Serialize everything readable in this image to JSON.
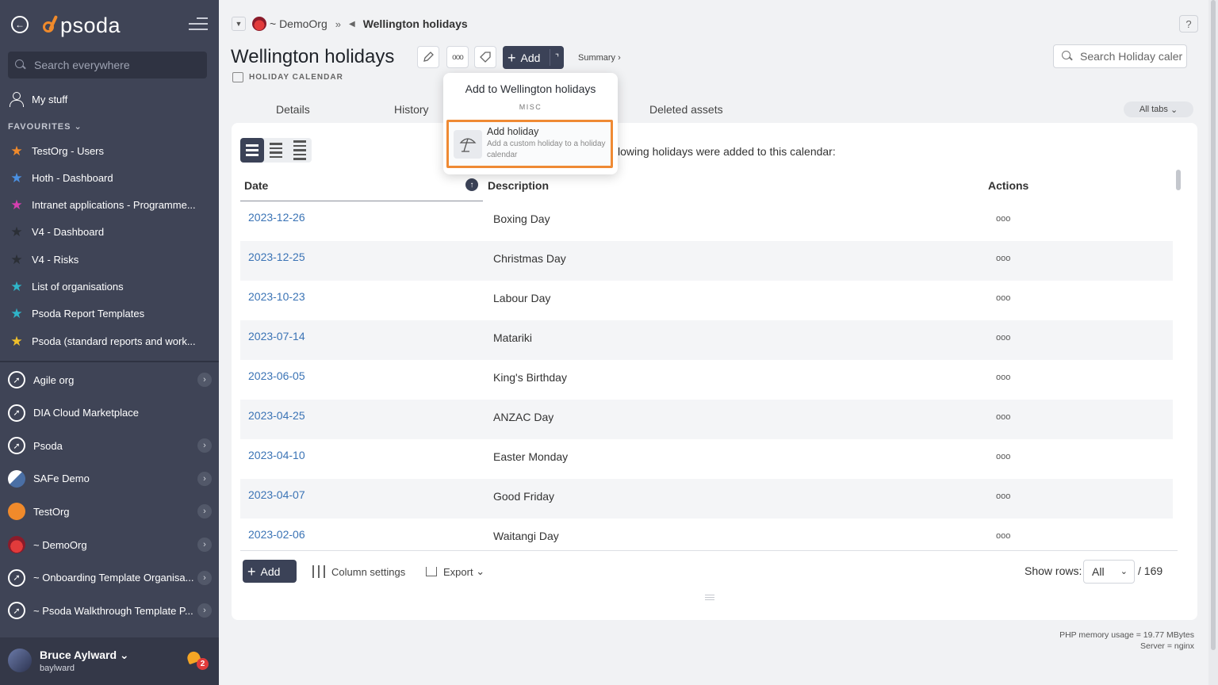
{
  "sidebar": {
    "logo_text": "psoda",
    "search_placeholder": "Search everywhere",
    "my_stuff": "My stuff",
    "favourites_heading": "FAVOURITES",
    "favourites": [
      {
        "label": "TestOrg - Users",
        "color": "#f08a2b"
      },
      {
        "label": "Hoth - Dashboard",
        "color": "#4a90e2"
      },
      {
        "label": "Intranet applications - Programme...",
        "color": "#d63fb0"
      },
      {
        "label": "V4 - Dashboard",
        "color": "#2b2f36"
      },
      {
        "label": "V4 - Risks",
        "color": "#2b2f36"
      },
      {
        "label": "List of organisations",
        "color": "#2fb5c9"
      },
      {
        "label": "Psoda Report Templates",
        "color": "#2fb5c9"
      },
      {
        "label": "Psoda (standard reports and work...",
        "color": "#f0c02b"
      }
    ],
    "orgs": [
      {
        "label": "Agile org",
        "has_chevron": true
      },
      {
        "label": "DIA Cloud Marketplace",
        "has_chevron": false
      },
      {
        "label": "Psoda",
        "has_chevron": true
      },
      {
        "label": "SAFe Demo",
        "has_chevron": true
      },
      {
        "label": "TestOrg",
        "has_chevron": true
      },
      {
        "label": "~ DemoOrg",
        "has_chevron": true
      },
      {
        "label": "~ Onboarding Template Organisa...",
        "has_chevron": true
      },
      {
        "label": "~ Psoda Walkthrough Template P...",
        "has_chevron": true
      }
    ],
    "user": {
      "name": "Bruce Aylward",
      "handle": "baylward",
      "notifications": "2"
    }
  },
  "breadcrumb": {
    "org": "~ DemoOrg",
    "current": "Wellington holidays"
  },
  "page": {
    "title": "Wellington holidays",
    "subtype": "HOLIDAY CALENDAR",
    "add_label": "Add",
    "summary_label": "Summary ›",
    "search_placeholder": "Search Holiday caler",
    "help": "?"
  },
  "tabs": [
    "Details",
    "History",
    "Deleted assets"
  ],
  "all_tabs": "All tabs",
  "popup": {
    "title": "Add to Wellington holidays",
    "heading": "MISC",
    "item_name": "Add holiday",
    "item_desc": "Add a custom holiday to a holiday calendar"
  },
  "table": {
    "intro": "lowing holidays were added to this calendar:",
    "columns": [
      "Date",
      "Description",
      "Actions"
    ],
    "rows": [
      {
        "date": "2023-12-26",
        "desc": "Boxing Day"
      },
      {
        "date": "2023-12-25",
        "desc": "Christmas Day"
      },
      {
        "date": "2023-10-23",
        "desc": "Labour Day"
      },
      {
        "date": "2023-07-14",
        "desc": "Matariki"
      },
      {
        "date": "2023-06-05",
        "desc": "King's Birthday"
      },
      {
        "date": "2023-04-25",
        "desc": "ANZAC Day"
      },
      {
        "date": "2023-04-10",
        "desc": "Easter Monday"
      },
      {
        "date": "2023-04-07",
        "desc": "Good Friday"
      },
      {
        "date": "2023-02-06",
        "desc": "Waitangi Day"
      }
    ],
    "actions_glyph": "ooo"
  },
  "footer": {
    "add_label": "Add",
    "column_settings": "Column settings",
    "export": "Export",
    "show_rows_label": "Show rows:",
    "show_rows_value": "All",
    "total": "/ 169"
  },
  "memory": {
    "line1": "PHP memory usage = 19.77 MBytes",
    "line2": "Server = nginx"
  }
}
